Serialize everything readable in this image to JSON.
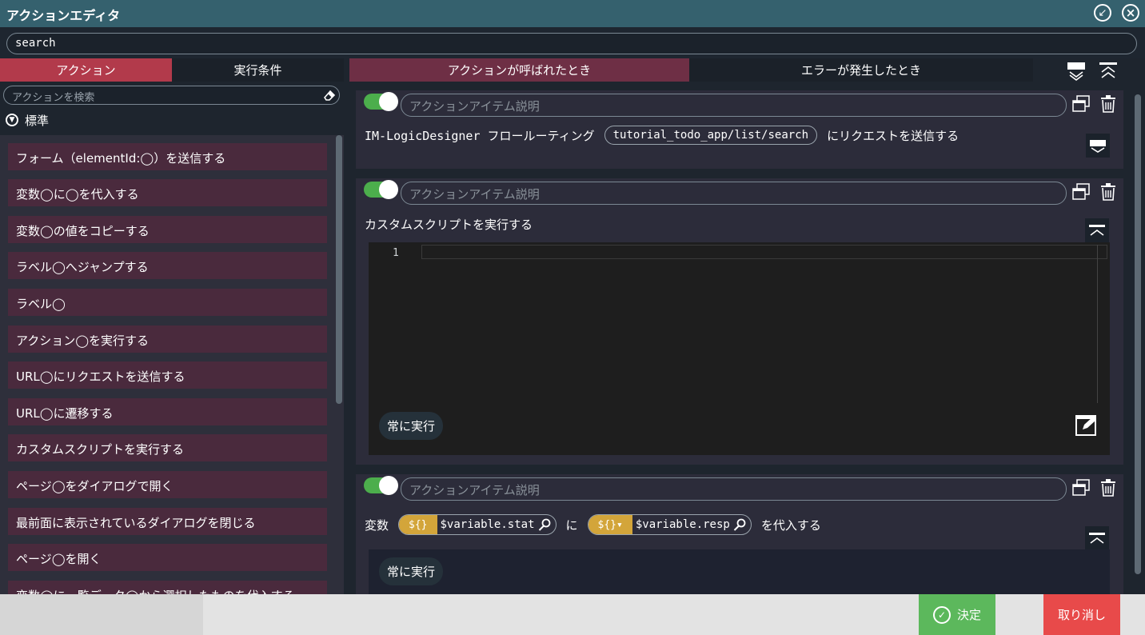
{
  "window": {
    "title": "アクションエディタ"
  },
  "name_field": {
    "value": "search"
  },
  "left_panel": {
    "tabs": [
      "アクション",
      "実行条件"
    ],
    "search_placeholder": "アクションを検索",
    "category": "標準",
    "items": [
      "フォーム（elementId:◯）を送信する",
      "変数◯に◯を代入する",
      "変数◯の値をコピーする",
      "ラベル◯へジャンプする",
      "ラベル◯",
      "アクション◯を実行する",
      "URL◯にリクエストを送信する",
      "URL◯に遷移する",
      "カスタムスクリプトを実行する",
      "ページ◯をダイアログで開く",
      "最前面に表示されているダイアログを閉じる",
      "ページ◯を開く",
      "変数◯に一覧データ◯から選択したものを代入する"
    ]
  },
  "right_panel": {
    "tabs": [
      "アクションが呼ばれたとき",
      "エラーが発生したとき"
    ],
    "description_placeholder": "アクションアイテム説明",
    "card1": {
      "prefix": "IM-LogicDesigner フロールーティング",
      "route": "tutorial_todo_app/list/search",
      "suffix": "にリクエストを送信する"
    },
    "card2": {
      "title": "カスタムスクリプトを実行する",
      "line_number": "1",
      "condition": "常に実行"
    },
    "card3": {
      "label_var": "変数",
      "dollar1": "${}",
      "value1": "$variable.stat",
      "label_ni": "に",
      "dollar2": "${}▾",
      "value2": "$variable.resp",
      "suffix": "を代入する",
      "condition": "常に実行"
    }
  },
  "footer": {
    "ok_label": "決定",
    "cancel_label": "取り消し"
  },
  "colors": {
    "titlebar": "#35616e",
    "active_tab": "#b23a4b",
    "item_bg": "#4a2a3d",
    "toggle_on": "#4cae4c",
    "ok": "#5cb85c",
    "cancel": "#e84a4a",
    "variable_badge": "#d3a53a"
  }
}
